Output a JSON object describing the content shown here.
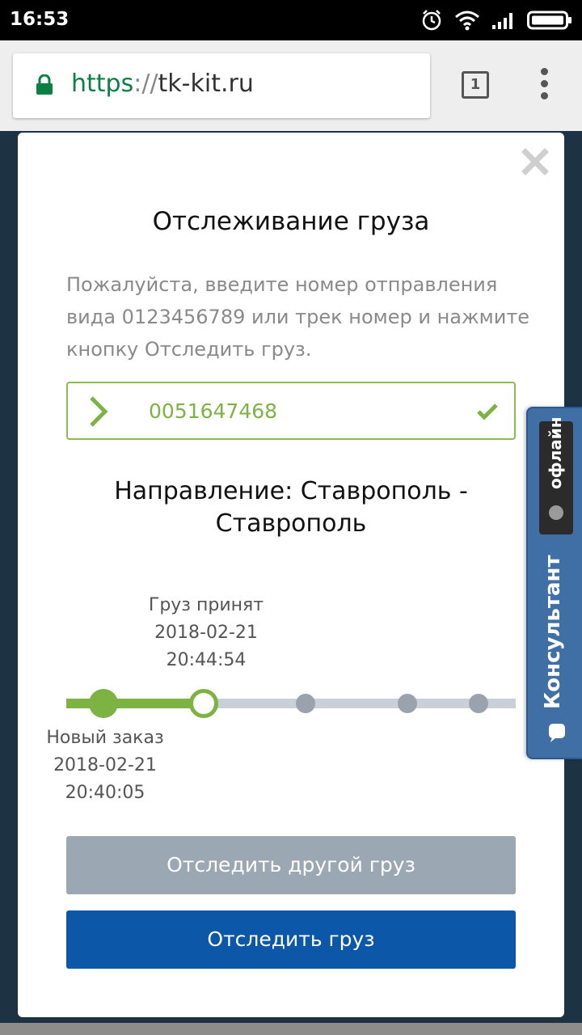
{
  "status_bar": {
    "time": "16:53"
  },
  "browser": {
    "url_scheme": "https",
    "url_sep": "://",
    "url_host": "tk-kit.ru",
    "tab_count": "1"
  },
  "modal": {
    "title": "Отслеживание груза",
    "description": "Пожалуйста, введите номер отправления вида 0123456789 или трек номер и нажмите кнопку Отследить груз.",
    "track_number": "0051647468",
    "direction_line1": "Направление: Ставрополь -",
    "direction_line2": "Ставрополь",
    "timeline": {
      "accepted": {
        "label": "Груз принят",
        "date": "2018-02-21",
        "time": "20:44:54"
      },
      "new_order": {
        "label": "Новый заказ",
        "date": "2018-02-21",
        "time": "20:40:05"
      },
      "completed_steps": 2,
      "total_steps": 5
    },
    "btn_other": "Отследить другой груз",
    "btn_track": "Отследить груз"
  },
  "consultant": {
    "status": "офлайн",
    "label": "Консультант"
  },
  "colors": {
    "accent_green": "#7cb342",
    "primary_blue": "#0d57a8",
    "secondary_gray": "#9ba7b3",
    "widget_blue": "#3f6fa5"
  }
}
